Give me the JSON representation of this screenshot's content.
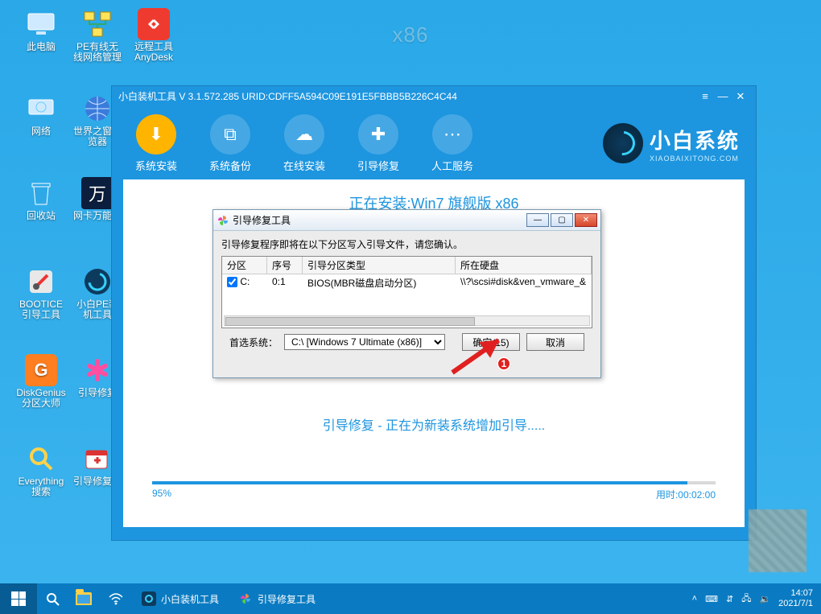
{
  "desktop": {
    "watermark": "x86",
    "icons": [
      {
        "label": "此电脑"
      },
      {
        "label": "PE有线无线网络管理"
      },
      {
        "label": "远程工具AnyDesk"
      },
      {
        "label": "网络"
      },
      {
        "label": "世界之窗浏览器"
      },
      {
        "label": "回收站"
      },
      {
        "label": "网卡万能驱"
      },
      {
        "label": "BOOTICE引导工具"
      },
      {
        "label": "小白PE装机工具"
      },
      {
        "label": "DiskGenius分区大师"
      },
      {
        "label": "引导修复"
      },
      {
        "label": "Everything搜索"
      },
      {
        "label": "引导修复工"
      }
    ]
  },
  "main_window": {
    "title": "小白装机工具 V 3.1.572.285 URID:CDFF5A594C09E191E5FBBB5B226C4C44",
    "toolbar": [
      {
        "label": "系统安装"
      },
      {
        "label": "系统备份"
      },
      {
        "label": "在线安装"
      },
      {
        "label": "引导修复"
      },
      {
        "label": "人工服务"
      }
    ],
    "brand_title": "小白系统",
    "brand_sub": "XIAOBAIXITONG.COM",
    "installing_text": "正在安装:Win7 旗舰版 x86",
    "status_text": "引导修复 - 正在为新装系统增加引导.....",
    "progress_percent": "95%",
    "progress_value": 95,
    "elapsed_label": "用时:00:02:00"
  },
  "dialog": {
    "title": "引导修复工具",
    "message": "引导修复程序即将在以下分区写入引导文件，请您确认。",
    "columns": {
      "c1": "分区",
      "c2": "序号",
      "c3": "引导分区类型",
      "c4": "所在硬盘"
    },
    "row": {
      "checked": true,
      "part": "C:",
      "idx": "0:1",
      "type": "BIOS(MBR磁盘启动分区)",
      "disk": "\\\\?\\scsi#disk&ven_vmware_&"
    },
    "pref_label": "首选系统：",
    "pref_value": "C:\\ [Windows 7 Ultimate (x86)]",
    "ok_label": "确定(15)",
    "cancel_label": "取消"
  },
  "annotation": {
    "bullet": "1"
  },
  "taskbar": {
    "items": [
      {
        "label": "小白装机工具"
      },
      {
        "label": "引导修复工具"
      }
    ],
    "clock_time": "14:07",
    "clock_date": "2021/7/1"
  },
  "colors": {
    "accent": "#1d95df",
    "warn": "#e02020",
    "orange": "#ffb400"
  }
}
